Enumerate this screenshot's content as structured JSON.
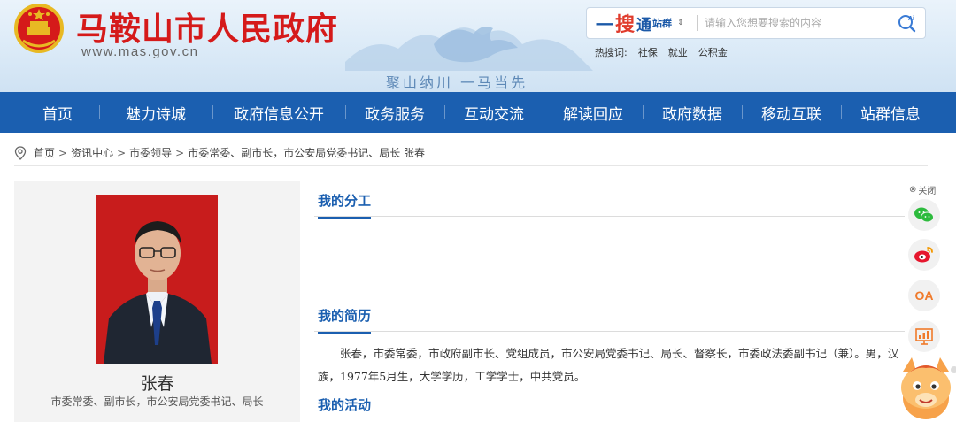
{
  "site": {
    "title": "马鞍山市人民政府",
    "url": "www.mas.gov.cn",
    "slogan": "聚山纳川  一马当先"
  },
  "search": {
    "brand_yi": "一",
    "brand_sou": "搜",
    "brand_tong": "通",
    "scope": "站群",
    "placeholder": "请输入您想要搜索的内容",
    "hot_label": "热搜词:",
    "hot_words": [
      "社保",
      "就业",
      "公积金"
    ]
  },
  "nav": {
    "items": [
      "首页",
      "魅力诗城",
      "政府信息公开",
      "政务服务",
      "互动交流",
      "解读回应",
      "政府数据",
      "移动互联",
      "站群信息"
    ]
  },
  "breadcrumb": {
    "items": [
      "首页",
      "资讯中心",
      "市委领导",
      "市委常委、副市长，市公安局党委书记、局长 张春"
    ],
    "separator": ">"
  },
  "profile": {
    "name": "张春",
    "title": "市委常委、副市长，市公安局党委书记、局长"
  },
  "sections": {
    "duty": "我的分工",
    "resume": "我的简历",
    "activity": "我的活动"
  },
  "resume_text": "张春，市委常委，市政府副市长、党组成员，市公安局党委书记、局长、督察长，市委政法委副书记（兼）。男，汉族，1977年5月生，大学学历，工学学士，中共党员。",
  "sidebar": {
    "close_label": "关闭",
    "oa_label": "OA",
    "buttons": [
      "wechat-icon",
      "weibo-icon",
      "oa-icon",
      "chart-icon"
    ]
  },
  "colors": {
    "brand_red": "#d51a1a",
    "nav_blue": "#1b5fb0",
    "section_blue": "#1b5fb0"
  }
}
